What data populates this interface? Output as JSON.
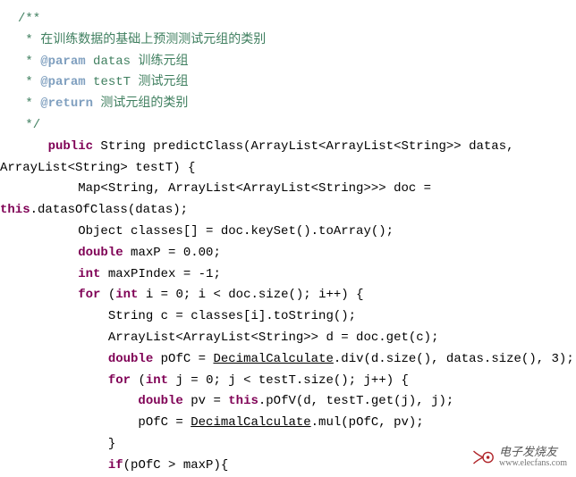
{
  "comment": {
    "open": "/**",
    "l1_prefix": " * ",
    "l1_text": "在训练数据的基础上预测测试元组的类别",
    "l2_prefix": " * ",
    "l2_tag": "@param",
    "l2_rest": " datas 训练元组",
    "l3_prefix": " * ",
    "l3_tag": "@param",
    "l3_rest": " testT 测试元组",
    "l4_prefix": " * ",
    "l4_tag": "@return",
    "l4_rest": " 测试元组的类别",
    "close": " */"
  },
  "code": {
    "sig1_kw": "    public",
    "sig1_rest": " String predictClass(ArrayList<ArrayList<String>> datas,",
    "sig2": "ArrayList<String> testT) {",
    "map1": "        Map<String, ArrayList<ArrayList<String>>> doc =",
    "map2a": "this",
    "map2b": ".datasOfClass(datas);",
    "obj": "        Object classes[] = doc.keySet().toArray();",
    "d1a": "        ",
    "d1b": "double",
    "d1c": " maxP = 0.00;",
    "d2a": "        ",
    "d2b": "int",
    "d2c": " maxPIndex = -1;",
    "for1a": "        ",
    "for1b": "for",
    "for1c": " (",
    "for1d": "int",
    "for1e": " i = 0; i < doc.size(); i++) {",
    "s1": "            String c = classes[i].toString();",
    "s2": "            ArrayList<ArrayList<String>> d = doc.get(c);",
    "p1a": "            ",
    "p1b": "double",
    "p1c": " pOfC = ",
    "p1d": "DecimalCalculate",
    "p1e": ".div(d.size(), datas.size(), 3);",
    "for2a": "            ",
    "for2b": "for",
    "for2c": " (",
    "for2d": "int",
    "for2e": " j = 0; j < testT.size(); j++) {",
    "pv1a": "                ",
    "pv1b": "double",
    "pv1c": " pv = ",
    "pv1d": "this",
    "pv1e": ".pOfV(d, testT.get(j), j);",
    "pv2a": "                pOfC = ",
    "pv2b": "DecimalCalculate",
    "pv2c": ".mul(pOfC, pv);",
    "close2": "            }",
    "if1a": "            ",
    "if1b": "if",
    "if1c": "(pOfC > maxP){"
  },
  "footer": {
    "cn": "电子发烧友",
    "url": "www.elecfans.com"
  }
}
